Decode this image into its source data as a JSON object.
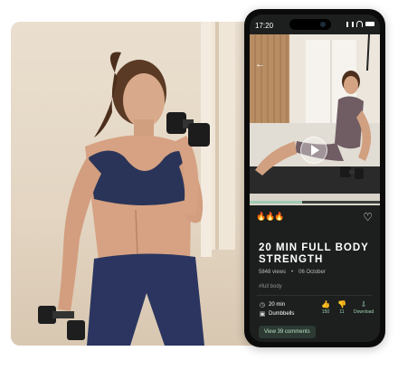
{
  "status": {
    "time": "17:20"
  },
  "video": {
    "progress": 0.4
  },
  "workout": {
    "title": "20 MIN FULL BODY STRENGTH",
    "views": "5848 views",
    "date": "06 October",
    "tag": "#full body",
    "duration": "20 min",
    "equipment": "Dumbbells",
    "likes": "150",
    "dislikes": "11",
    "download_label": "Download"
  },
  "buttons": {
    "comments": "View 39 comments"
  },
  "icons": {
    "back": "arrow-left-icon",
    "play": "play-icon",
    "heart": "heart-icon",
    "flame": "flame-icon",
    "clock": "clock-icon",
    "dumbbell": "dumbbell-icon",
    "thumbs_up": "thumbs-up-icon",
    "thumbs_down": "thumbs-down-icon",
    "download": "cloud-download-icon"
  },
  "colors": {
    "accent_green": "#9fd5b3",
    "screen_bg": "#1c1f1e",
    "flame": "#f07a3a"
  }
}
